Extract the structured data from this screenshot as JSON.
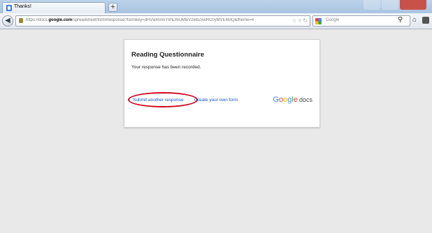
{
  "browser": {
    "tab_title": "Thanks!",
    "new_tab_label": "+",
    "url_prefix": "https://docs.",
    "url_domain": "google.com",
    "url_path": "/spreadsheet/formResponse?formkey=dHVwR0x5YkhDNUMwVzlkb2xwRC0yMVE6MQ&theme=4",
    "search_placeholder": "Google"
  },
  "page": {
    "form_title": "Reading Questionnaire",
    "message": "Your response has been recorded.",
    "submit_link": "Submit another response",
    "create_link": "Create your own form",
    "brand_logo": "Google",
    "brand_suffix": "docs"
  },
  "colors": {
    "link": "#1155cc",
    "highlight_ring": "#d0021b"
  }
}
